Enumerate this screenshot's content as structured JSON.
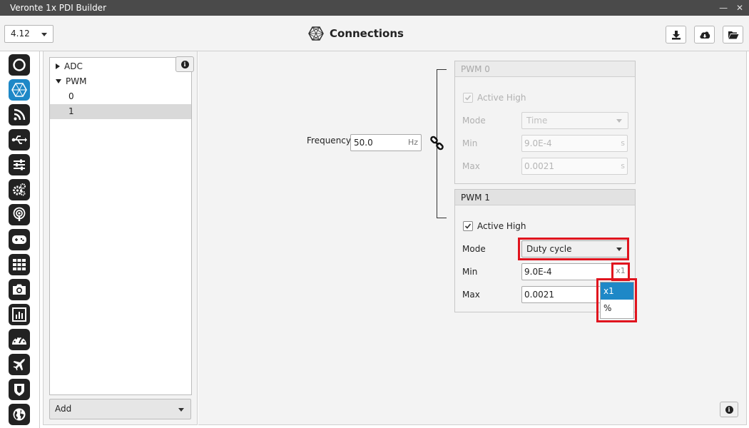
{
  "window": {
    "title": "Veronte 1x PDI Builder",
    "controls": [
      "—",
      "✕"
    ]
  },
  "header": {
    "version": "4.12",
    "title": "Connections",
    "buttons": [
      "download-icon",
      "cloud-download-icon",
      "folder-open-icon"
    ]
  },
  "sidebar": {
    "icons": [
      "power-icon",
      "connections-icon",
      "rss-icon",
      "usb-icon",
      "sliders-icon",
      "gears-icon",
      "podcast-icon",
      "gamepad-icon",
      "grid-icon",
      "camera-icon",
      "chart-icon",
      "dashboard-icon",
      "plane-icon",
      "shield-icon",
      "globe-icon"
    ],
    "active": "connections-icon"
  },
  "tree": {
    "items": [
      {
        "label": "ADC",
        "expanded": false
      },
      {
        "label": "PWM",
        "expanded": true
      },
      {
        "label": "0"
      },
      {
        "label": "1",
        "selected": true
      }
    ],
    "add_label": "Add"
  },
  "frequency": {
    "label": "Frequency",
    "value": "50.0",
    "unit": "Hz"
  },
  "pwm0": {
    "title": "PWM 0",
    "active_high_label": "Active High",
    "active_high": true,
    "mode_label": "Mode",
    "mode_value": "Time",
    "min_label": "Min",
    "min_value": "9.0E-4",
    "min_unit": "s",
    "max_label": "Max",
    "max_value": "0.0021",
    "max_unit": "s"
  },
  "pwm1": {
    "title": "PWM 1",
    "active_high_label": "Active High",
    "active_high": true,
    "mode_label": "Mode",
    "mode_value": "Duty cycle",
    "min_label": "Min",
    "min_value": "9.0E-4",
    "min_unit": "x1",
    "max_label": "Max",
    "max_value": "0.0021"
  },
  "unit_dropdown": {
    "options": [
      "x1",
      "%"
    ],
    "selected": "x1"
  },
  "colors": {
    "highlight": "#e0141e",
    "accent": "#1e88c7",
    "titlebar": "#4a4a4a"
  }
}
